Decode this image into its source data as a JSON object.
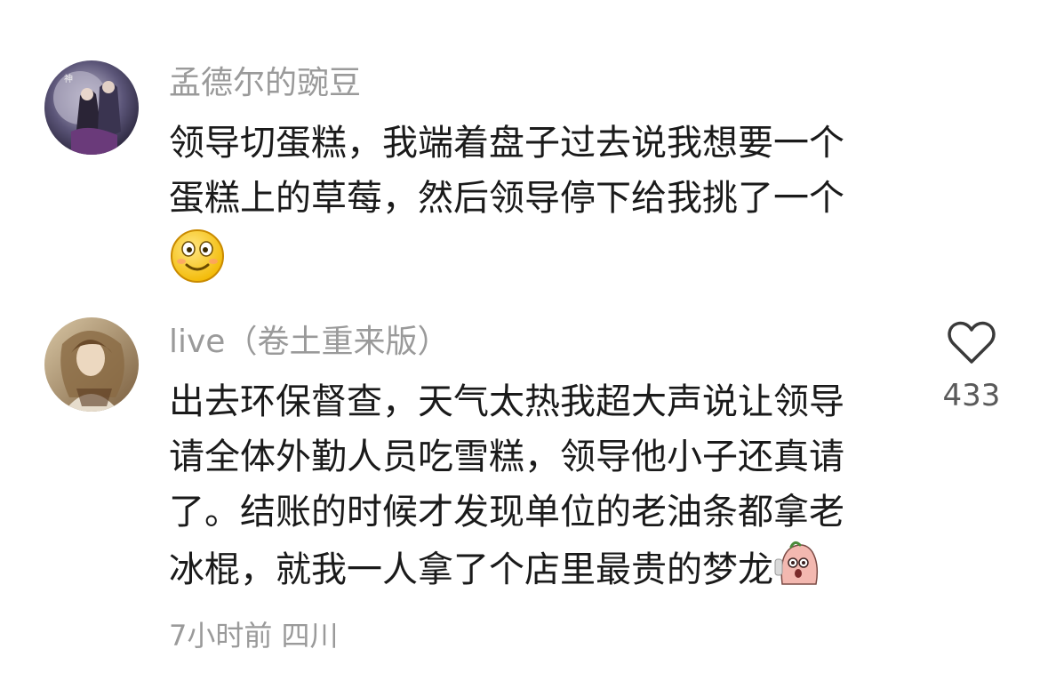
{
  "comments": [
    {
      "username": "孟德尔的豌豆",
      "lines": [
        "领导切蛋糕，我端着盘子过去说我想要一个",
        "蛋糕上的草莓，然后领导停下给我挑了一个"
      ],
      "trailing_emoji": "smiling-face-icon"
    },
    {
      "username": "live（卷土重来版）",
      "lines": [
        "出去环保督查，天气太热我超大声说让领导",
        "请全体外勤人员吃雪糕，领导他小子还真请",
        "了。结账的时候才发现单位的老油条都拿老",
        "冰棍，就我一人拿了个店里最贵的梦龙"
      ],
      "inline_emoji": "shocked-bean-sticker-icon",
      "timestamp": "7小时前",
      "location": "四川",
      "likes": "433",
      "like_icon": "heart-outline-icon"
    }
  ]
}
